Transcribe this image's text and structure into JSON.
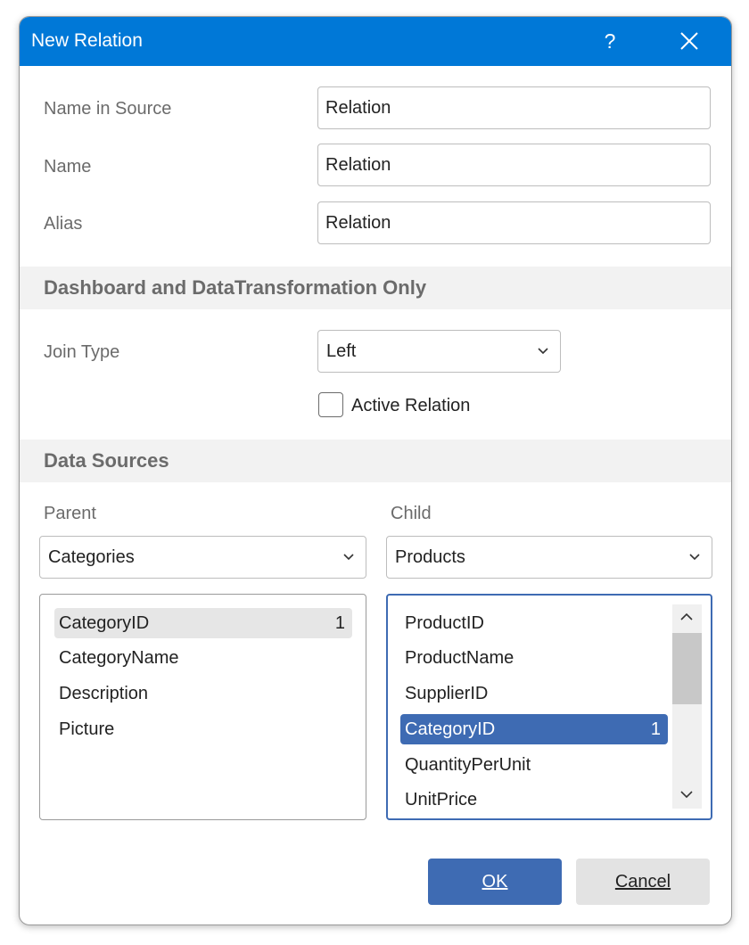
{
  "window": {
    "title": "New Relation",
    "help_label": "?",
    "accent_color": "#0078d7"
  },
  "form": {
    "name_in_source_label": "Name in Source",
    "name_in_source_value": "Relation",
    "name_label": "Name",
    "name_value": "Relation",
    "alias_label": "Alias",
    "alias_value": "Relation"
  },
  "dashboard_section": {
    "title": "Dashboard and DataTransformation Only",
    "join_type_label": "Join Type",
    "join_type_value": "Left",
    "active_relation_label": "Active Relation",
    "active_relation_checked": false
  },
  "data_sources": {
    "title": "Data Sources",
    "parent_label": "Parent",
    "parent_value": "Categories",
    "child_label": "Child",
    "child_value": "Products",
    "parent_columns": [
      {
        "name": "CategoryID",
        "index": "1"
      },
      {
        "name": "CategoryName",
        "index": ""
      },
      {
        "name": "Description",
        "index": ""
      },
      {
        "name": "Picture",
        "index": ""
      }
    ],
    "child_columns": [
      {
        "name": "ProductID",
        "index": ""
      },
      {
        "name": "ProductName",
        "index": ""
      },
      {
        "name": "SupplierID",
        "index": ""
      },
      {
        "name": "CategoryID",
        "index": "1"
      },
      {
        "name": "QuantityPerUnit",
        "index": ""
      },
      {
        "name": "UnitPrice",
        "index": ""
      }
    ]
  },
  "buttons": {
    "ok_label": "OK",
    "cancel_label": "Cancel"
  },
  "colors": {
    "selection": "#3e6bb3",
    "section_bg": "#f2f2f2"
  }
}
